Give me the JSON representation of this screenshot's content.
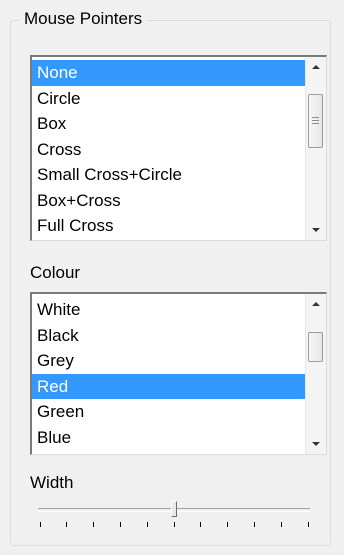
{
  "mouse_pointers": {
    "title": "Mouse Pointers",
    "items": [
      "None",
      "Circle",
      "Box",
      "Cross",
      "Small Cross+Circle",
      "Box+Cross",
      "Full Cross"
    ],
    "selected_index": 0
  },
  "colour": {
    "label": "Colour",
    "items": [
      "White",
      "Black",
      "Grey",
      "Red",
      "Green",
      "Blue"
    ],
    "selected_index": 3
  },
  "width": {
    "label": "Width",
    "min": 0,
    "max": 10,
    "value": 5,
    "tick_count": 11
  },
  "colors": {
    "selection": "#3399ff",
    "window_bg": "#f0f0f0"
  }
}
